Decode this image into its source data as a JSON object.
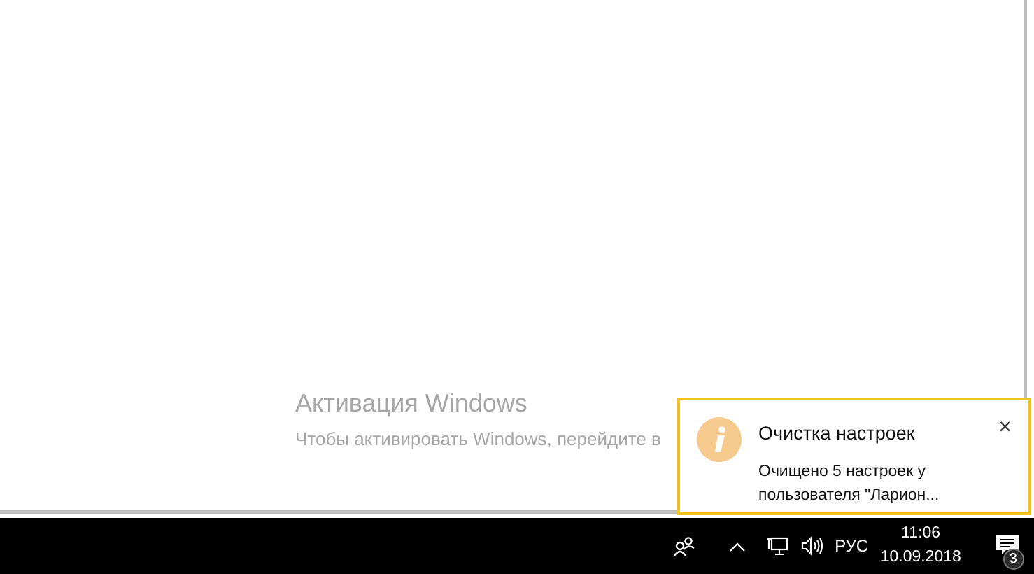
{
  "watermark": {
    "title": "Активация Windows",
    "text": "Чтобы активировать Windows, перейдите в"
  },
  "toast": {
    "title": "Очистка настроек",
    "close": "×",
    "message": "Очищено 5 настроек у пользователя \"Ларион..."
  },
  "taskbar": {
    "language": "РУС",
    "time": "11:06",
    "date": "10.09.2018",
    "notifications_count": "3"
  }
}
